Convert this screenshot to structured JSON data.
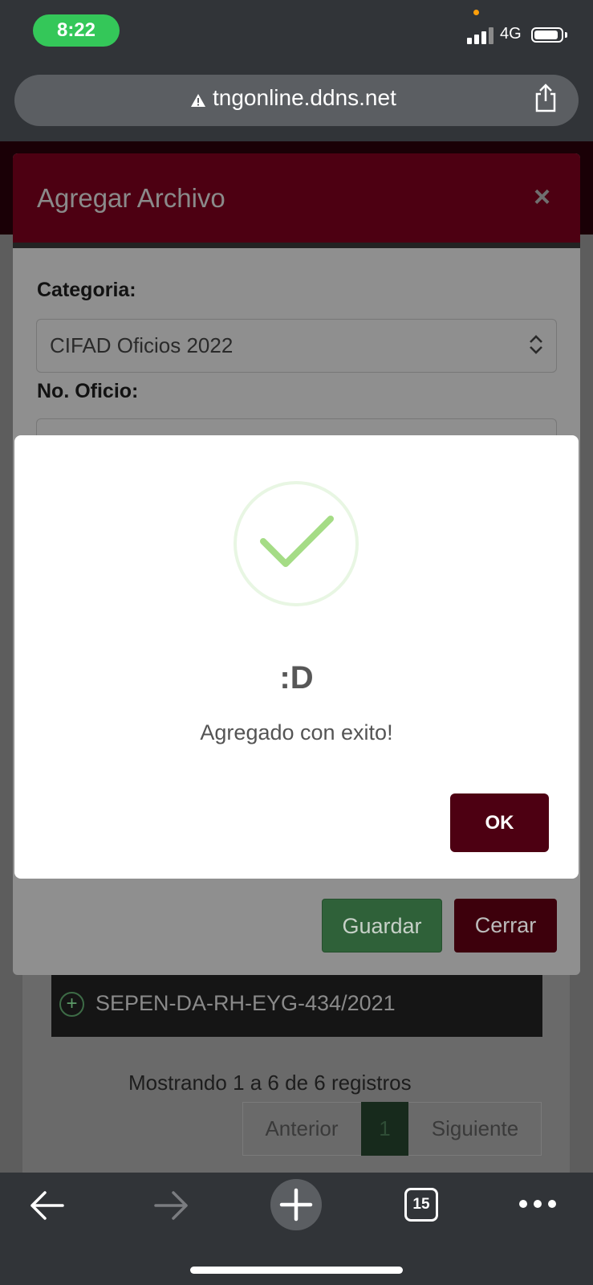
{
  "status_bar": {
    "time": "8:22",
    "network": "4G",
    "battery_level": 0.9
  },
  "browser": {
    "url": "tngonline.ddns.net",
    "tab_count": "15"
  },
  "modal": {
    "title": "Agregar Archivo",
    "close_glyph": "×",
    "categoria_label": "Categoria:",
    "categoria_value": "CIFAD Oficios 2022",
    "oficio_label": "No. Oficio:",
    "guardar_label": "Guardar",
    "cerrar_label": "Cerrar"
  },
  "background_page": {
    "row_text": "SEPEN-DA-RH-EYG-434/2021",
    "row_glyph": "+",
    "showing_text": "Mostrando 1 a 6 de 6 registros",
    "pager": {
      "prev": "Anterior",
      "current": "1",
      "next": "Siguiente"
    }
  },
  "alert": {
    "icon": "success-check-icon",
    "title": ":D",
    "text": "Agregado con exito!",
    "ok_label": "OK"
  },
  "colors": {
    "brand": "#4d0012",
    "success": "#a5dc86",
    "save_button": "#2f6139",
    "status_time": "#34c759"
  }
}
